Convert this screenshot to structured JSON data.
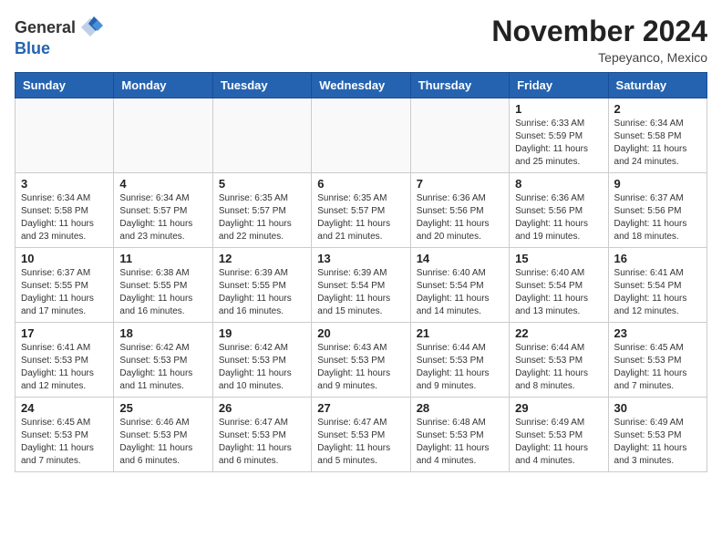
{
  "logo": {
    "general": "General",
    "blue": "Blue"
  },
  "title": "November 2024",
  "subtitle": "Tepeyanco, Mexico",
  "days_of_week": [
    "Sunday",
    "Monday",
    "Tuesday",
    "Wednesday",
    "Thursday",
    "Friday",
    "Saturday"
  ],
  "weeks": [
    [
      {
        "day": "",
        "info": ""
      },
      {
        "day": "",
        "info": ""
      },
      {
        "day": "",
        "info": ""
      },
      {
        "day": "",
        "info": ""
      },
      {
        "day": "",
        "info": ""
      },
      {
        "day": "1",
        "info": "Sunrise: 6:33 AM\nSunset: 5:59 PM\nDaylight: 11 hours and 25 minutes."
      },
      {
        "day": "2",
        "info": "Sunrise: 6:34 AM\nSunset: 5:58 PM\nDaylight: 11 hours and 24 minutes."
      }
    ],
    [
      {
        "day": "3",
        "info": "Sunrise: 6:34 AM\nSunset: 5:58 PM\nDaylight: 11 hours and 23 minutes."
      },
      {
        "day": "4",
        "info": "Sunrise: 6:34 AM\nSunset: 5:57 PM\nDaylight: 11 hours and 23 minutes."
      },
      {
        "day": "5",
        "info": "Sunrise: 6:35 AM\nSunset: 5:57 PM\nDaylight: 11 hours and 22 minutes."
      },
      {
        "day": "6",
        "info": "Sunrise: 6:35 AM\nSunset: 5:57 PM\nDaylight: 11 hours and 21 minutes."
      },
      {
        "day": "7",
        "info": "Sunrise: 6:36 AM\nSunset: 5:56 PM\nDaylight: 11 hours and 20 minutes."
      },
      {
        "day": "8",
        "info": "Sunrise: 6:36 AM\nSunset: 5:56 PM\nDaylight: 11 hours and 19 minutes."
      },
      {
        "day": "9",
        "info": "Sunrise: 6:37 AM\nSunset: 5:56 PM\nDaylight: 11 hours and 18 minutes."
      }
    ],
    [
      {
        "day": "10",
        "info": "Sunrise: 6:37 AM\nSunset: 5:55 PM\nDaylight: 11 hours and 17 minutes."
      },
      {
        "day": "11",
        "info": "Sunrise: 6:38 AM\nSunset: 5:55 PM\nDaylight: 11 hours and 16 minutes."
      },
      {
        "day": "12",
        "info": "Sunrise: 6:39 AM\nSunset: 5:55 PM\nDaylight: 11 hours and 16 minutes."
      },
      {
        "day": "13",
        "info": "Sunrise: 6:39 AM\nSunset: 5:54 PM\nDaylight: 11 hours and 15 minutes."
      },
      {
        "day": "14",
        "info": "Sunrise: 6:40 AM\nSunset: 5:54 PM\nDaylight: 11 hours and 14 minutes."
      },
      {
        "day": "15",
        "info": "Sunrise: 6:40 AM\nSunset: 5:54 PM\nDaylight: 11 hours and 13 minutes."
      },
      {
        "day": "16",
        "info": "Sunrise: 6:41 AM\nSunset: 5:54 PM\nDaylight: 11 hours and 12 minutes."
      }
    ],
    [
      {
        "day": "17",
        "info": "Sunrise: 6:41 AM\nSunset: 5:53 PM\nDaylight: 11 hours and 12 minutes."
      },
      {
        "day": "18",
        "info": "Sunrise: 6:42 AM\nSunset: 5:53 PM\nDaylight: 11 hours and 11 minutes."
      },
      {
        "day": "19",
        "info": "Sunrise: 6:42 AM\nSunset: 5:53 PM\nDaylight: 11 hours and 10 minutes."
      },
      {
        "day": "20",
        "info": "Sunrise: 6:43 AM\nSunset: 5:53 PM\nDaylight: 11 hours and 9 minutes."
      },
      {
        "day": "21",
        "info": "Sunrise: 6:44 AM\nSunset: 5:53 PM\nDaylight: 11 hours and 9 minutes."
      },
      {
        "day": "22",
        "info": "Sunrise: 6:44 AM\nSunset: 5:53 PM\nDaylight: 11 hours and 8 minutes."
      },
      {
        "day": "23",
        "info": "Sunrise: 6:45 AM\nSunset: 5:53 PM\nDaylight: 11 hours and 7 minutes."
      }
    ],
    [
      {
        "day": "24",
        "info": "Sunrise: 6:45 AM\nSunset: 5:53 PM\nDaylight: 11 hours and 7 minutes."
      },
      {
        "day": "25",
        "info": "Sunrise: 6:46 AM\nSunset: 5:53 PM\nDaylight: 11 hours and 6 minutes."
      },
      {
        "day": "26",
        "info": "Sunrise: 6:47 AM\nSunset: 5:53 PM\nDaylight: 11 hours and 6 minutes."
      },
      {
        "day": "27",
        "info": "Sunrise: 6:47 AM\nSunset: 5:53 PM\nDaylight: 11 hours and 5 minutes."
      },
      {
        "day": "28",
        "info": "Sunrise: 6:48 AM\nSunset: 5:53 PM\nDaylight: 11 hours and 4 minutes."
      },
      {
        "day": "29",
        "info": "Sunrise: 6:49 AM\nSunset: 5:53 PM\nDaylight: 11 hours and 4 minutes."
      },
      {
        "day": "30",
        "info": "Sunrise: 6:49 AM\nSunset: 5:53 PM\nDaylight: 11 hours and 3 minutes."
      }
    ]
  ]
}
